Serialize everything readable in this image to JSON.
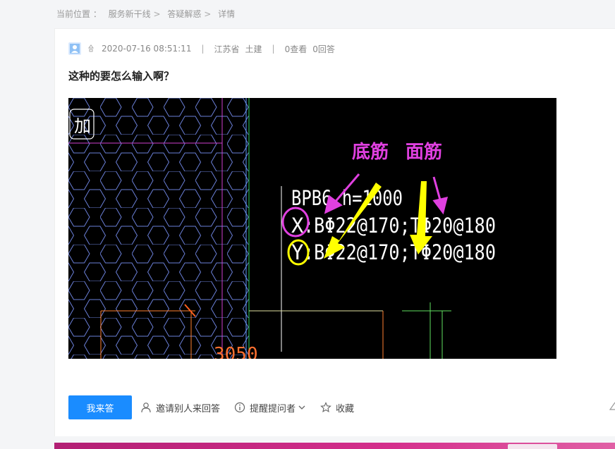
{
  "breadcrumb": {
    "label": "当前位置 ：",
    "items": [
      "服务新干线",
      "答疑解惑",
      "详情"
    ],
    "separator": ">"
  },
  "meta": {
    "timestamp": "2020-07-16 08:51:11",
    "divider": "|",
    "province": "江苏省",
    "category": "土建",
    "views": "0查看",
    "answers": "0回答"
  },
  "question": {
    "title": "这种的要怎么输入啊？"
  },
  "drawing": {
    "stamp": "加",
    "label_bottom": "底筋",
    "label_top": "面筋",
    "line1": "BPB6 h=1000",
    "line2_prefix": "X",
    "line2_rest": ":BΦ22@170;TΦ20@180",
    "line3_prefix": "Y",
    "line3_rest": ":BΦ22@170;TΦ20@180",
    "dimension": "3050"
  },
  "actions": {
    "answer": "我来答",
    "invite": "邀请别人来回答",
    "remind": "提醒提问者",
    "favorite": "收藏"
  },
  "colors": {
    "accent": "#1a8cff",
    "magenta": "#e040e0",
    "yellow": "#ffff00",
    "hex_grid": "#6a7fd8"
  }
}
